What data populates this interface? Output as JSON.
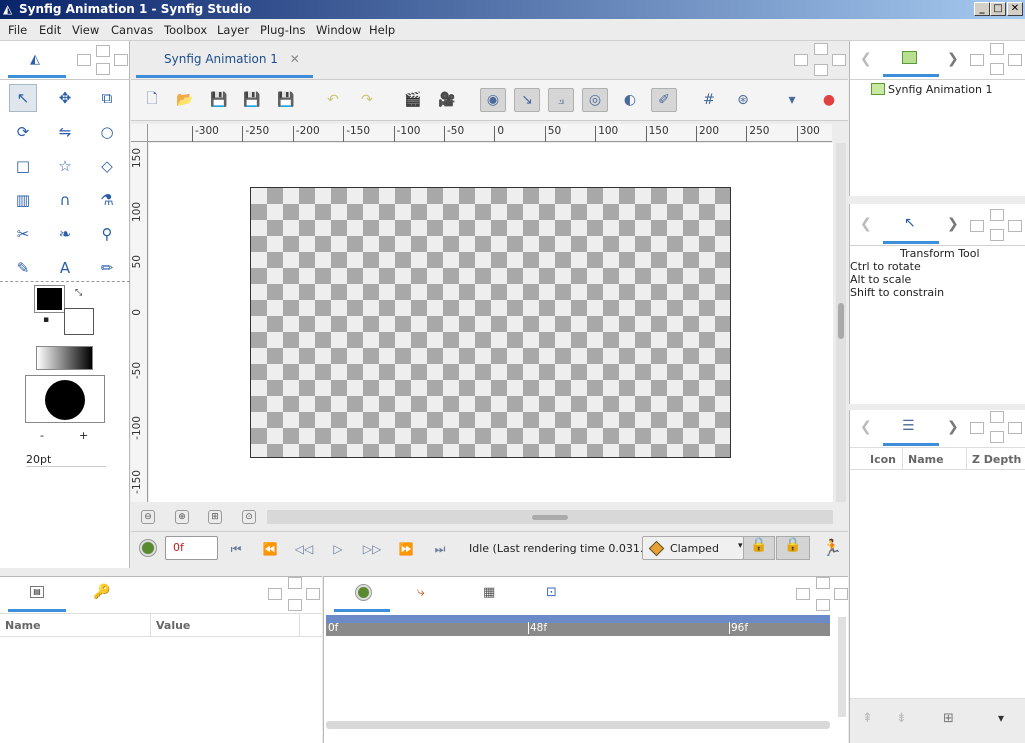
{
  "window": {
    "title": "Synfig Animation 1 - Synfig Studio",
    "minimize": "_",
    "maximize": "□",
    "close": "✕"
  },
  "menu": [
    "File",
    "Edit",
    "View",
    "Canvas",
    "Toolbox",
    "Layer",
    "Plug-Ins",
    "Window",
    "Help"
  ],
  "document_tab": {
    "title": "Synfig Animation 1",
    "close": "✕"
  },
  "toolbox": {
    "tools": [
      {
        "icon": "transform-tool-icon",
        "glyph": "↖"
      },
      {
        "icon": "smooth-move-tool-icon",
        "glyph": "✥"
      },
      {
        "icon": "scale-tool-icon",
        "glyph": "⧉"
      },
      {
        "icon": "rotate-tool-icon",
        "glyph": "⟳"
      },
      {
        "icon": "mirror-tool-icon",
        "glyph": "⇋"
      },
      {
        "icon": "circle-tool-icon",
        "glyph": "○"
      },
      {
        "icon": "rectangle-tool-icon",
        "glyph": "□"
      },
      {
        "icon": "star-tool-icon",
        "glyph": "☆"
      },
      {
        "icon": "polygon-tool-icon",
        "glyph": "◇"
      },
      {
        "icon": "gradient-tool-icon",
        "glyph": "▥"
      },
      {
        "icon": "spline-tool-icon",
        "glyph": "∩"
      },
      {
        "icon": "fill-tool-icon",
        "glyph": "⚗"
      },
      {
        "icon": "cutout-tool-icon",
        "glyph": "✂"
      },
      {
        "icon": "width-tool-icon",
        "glyph": "❧"
      },
      {
        "icon": "eyedrop-tool-icon",
        "glyph": "⚲"
      },
      {
        "icon": "draw-tool-icon",
        "glyph": "✎"
      },
      {
        "icon": "text-tool-icon",
        "glyph": "A"
      },
      {
        "icon": "sketch-tool-icon",
        "glyph": "✏"
      }
    ],
    "brush_minus": "-",
    "brush_plus": "+",
    "brush_size": "20pt",
    "swap": "⤡",
    "reset": "▪"
  },
  "toolbar": {
    "buttons": [
      {
        "icon": "new-file-icon",
        "glyph": "🗋"
      },
      {
        "icon": "open-file-icon",
        "glyph": "📂"
      },
      {
        "icon": "save-icon",
        "glyph": "💾"
      },
      {
        "icon": "save-as-icon",
        "glyph": "💾"
      },
      {
        "icon": "save-all-icon",
        "glyph": "💾"
      },
      {
        "icon": "undo-icon",
        "glyph": "↶"
      },
      {
        "icon": "redo-icon",
        "glyph": "↷"
      },
      {
        "icon": "render-icon",
        "glyph": "🎬"
      },
      {
        "icon": "preview-icon",
        "glyph": "🎥"
      },
      {
        "icon": "show-position-handles-icon",
        "glyph": "◉"
      },
      {
        "icon": "show-tangent-handles-icon",
        "glyph": "↘"
      },
      {
        "icon": "show-width-handles-icon",
        "glyph": "⟓"
      },
      {
        "icon": "show-radius-handles-icon",
        "glyph": "◎"
      },
      {
        "icon": "onion-skin-icon",
        "glyph": "◐"
      },
      {
        "icon": "toggle-ducks-icon",
        "glyph": "✐"
      },
      {
        "icon": "grid-icon",
        "glyph": "#"
      },
      {
        "icon": "snap-grid-icon",
        "glyph": "⊛"
      },
      {
        "icon": "toolbar-menu-icon",
        "glyph": "▾"
      },
      {
        "icon": "record-icon",
        "glyph": "●"
      }
    ]
  },
  "ruler": {
    "h": [
      "-300",
      "-250",
      "-200",
      "-150",
      "-100",
      "-50",
      "0",
      "50",
      "100",
      "150",
      "200",
      "250",
      "300"
    ],
    "v": [
      "150",
      "100",
      "50",
      "0",
      "-50",
      "-100",
      "-150"
    ]
  },
  "frame_controls": {
    "current_frame": "0f",
    "status": "Idle (Last rendering time 0.031...",
    "interpolation": "Clamped"
  },
  "canvas_browser": {
    "item": "Synfig Animation 1"
  },
  "tool_options": {
    "title": "Transform Tool",
    "lines": [
      "Ctrl to rotate",
      "Alt to scale",
      "Shift to constrain"
    ]
  },
  "layers": {
    "columns": [
      "Icon",
      "Name",
      "Z Depth"
    ]
  },
  "params": {
    "columns": [
      "Name",
      "Value"
    ]
  },
  "timetrack": {
    "labels": [
      "0f",
      "48f",
      "96f"
    ]
  }
}
